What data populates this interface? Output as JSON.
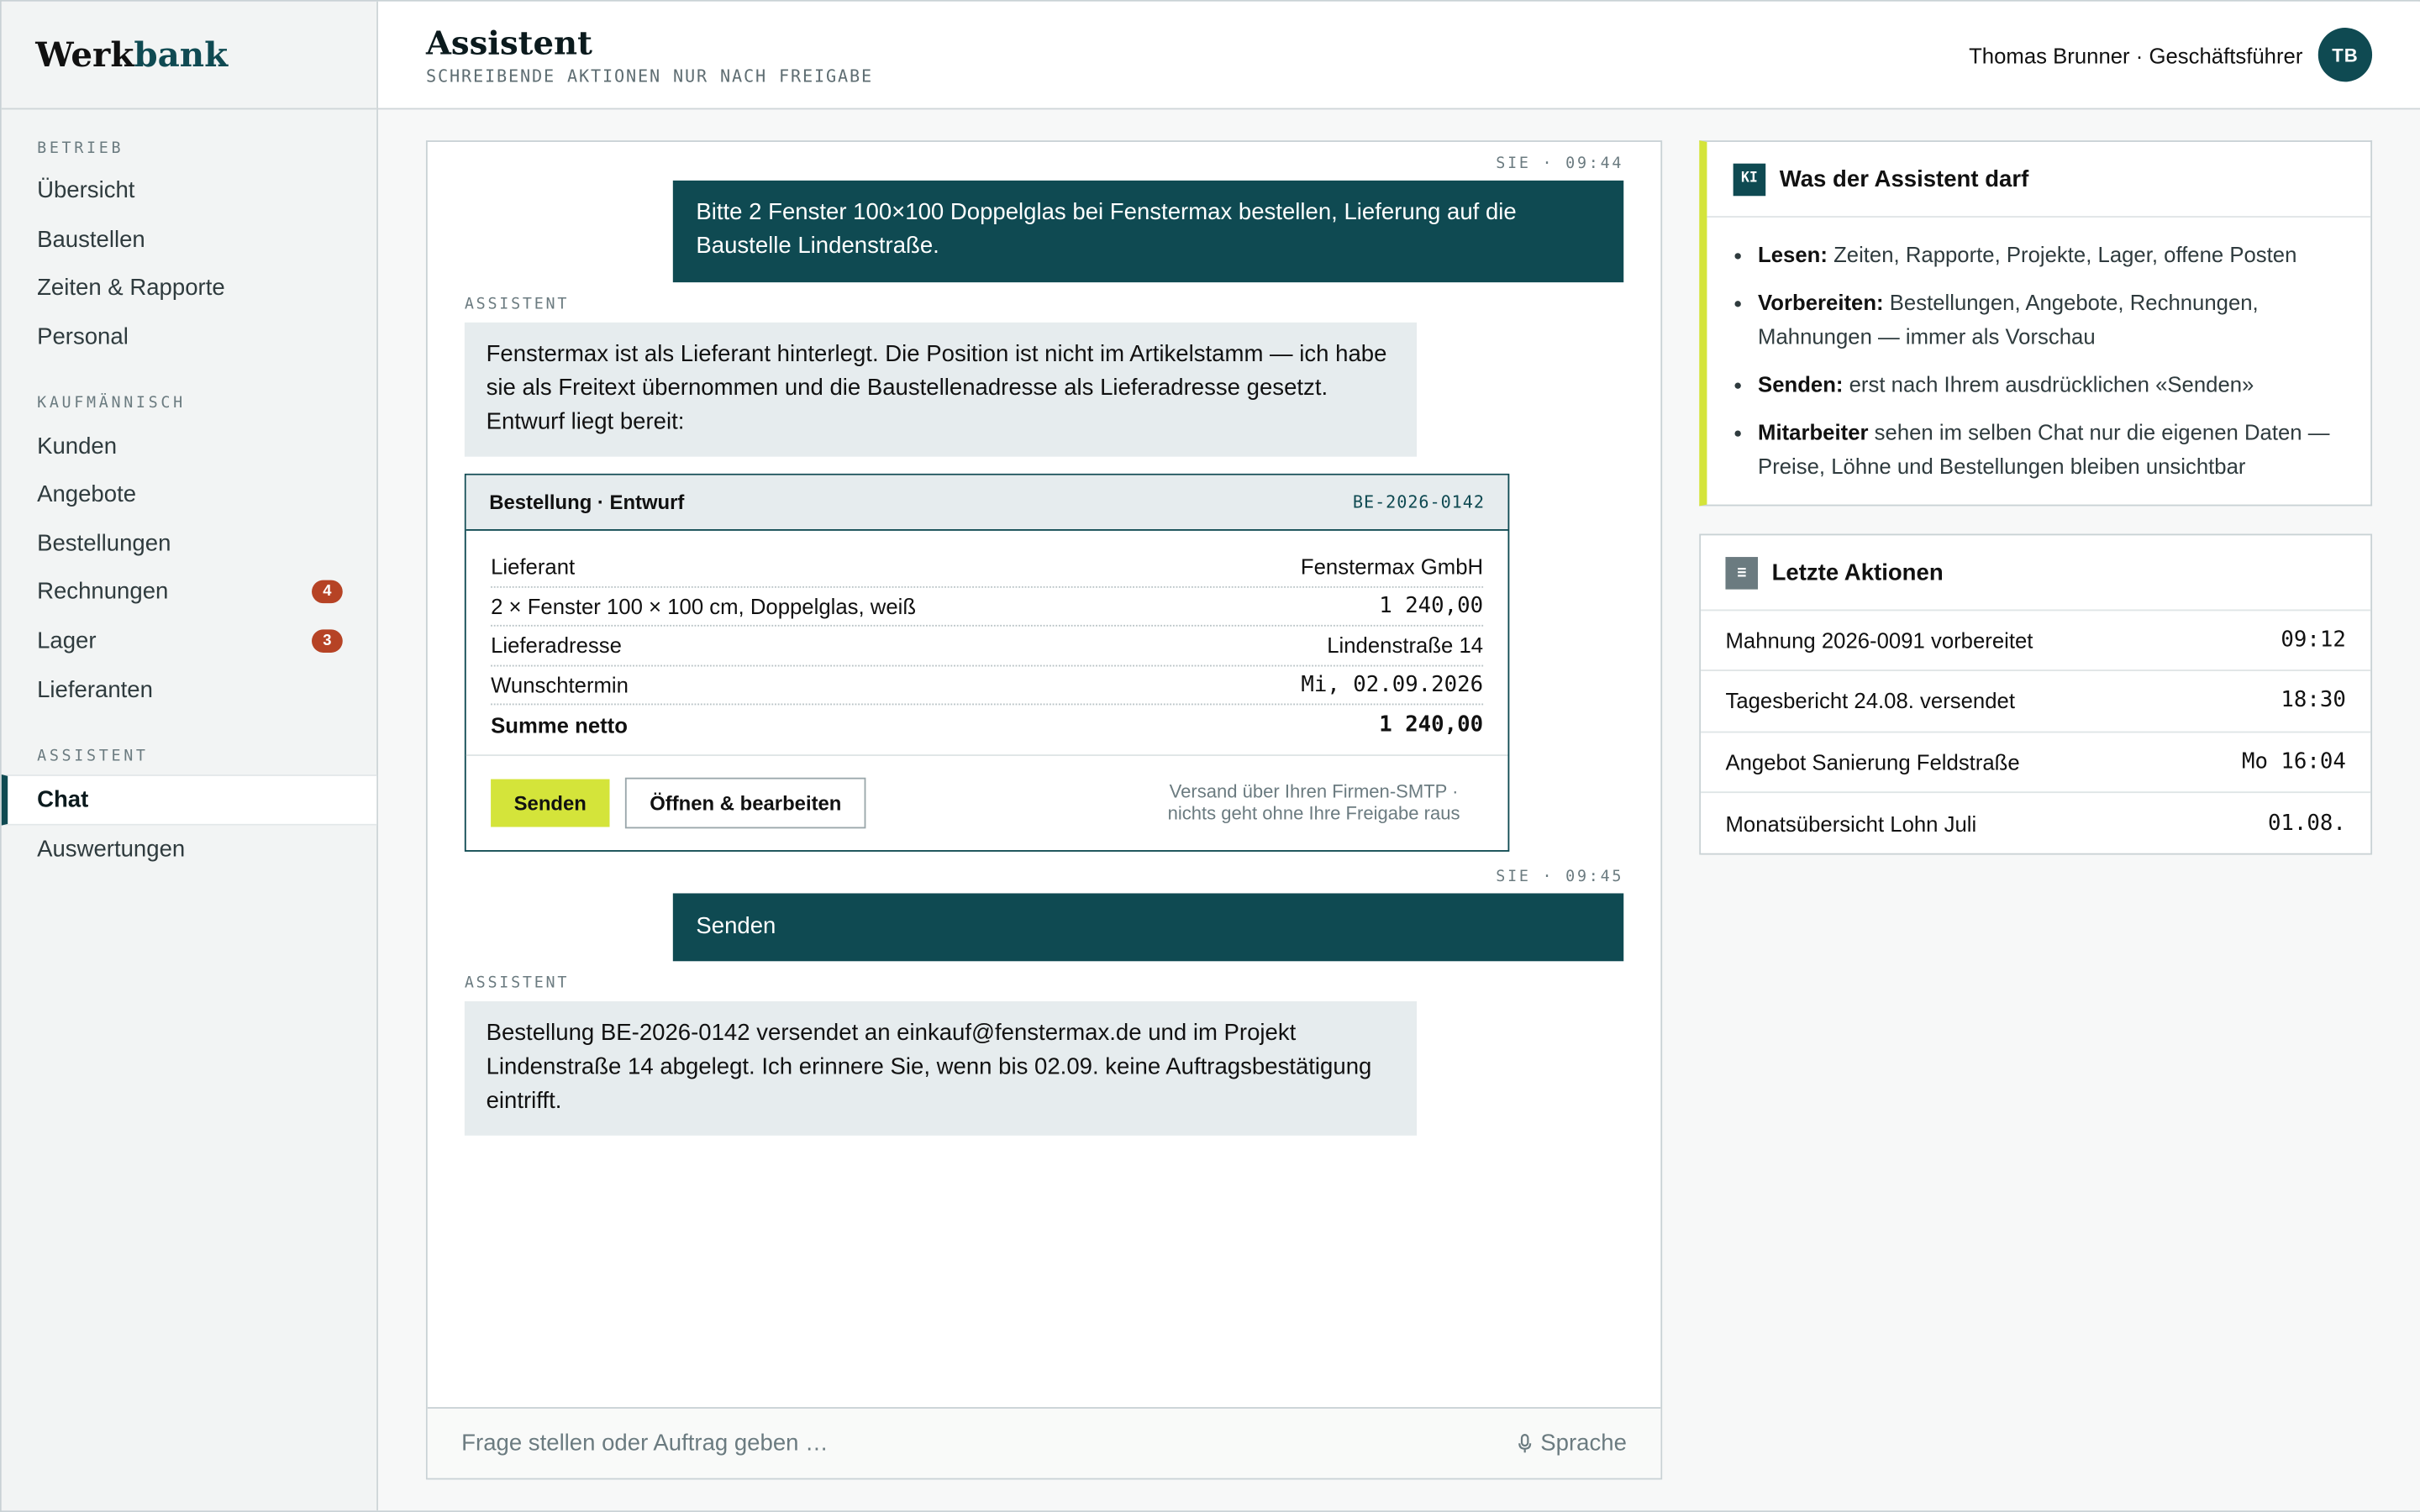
{
  "brand": {
    "part1": "Werk",
    "part2": "bank"
  },
  "sidebar": {
    "sections": [
      {
        "label": "BETRIEB"
      },
      {
        "label": "KAUFMÄNNISCH"
      },
      {
        "label": "ASSISTENT"
      }
    ],
    "items": [
      {
        "label": "Übersicht"
      },
      {
        "label": "Baustellen"
      },
      {
        "label": "Zeiten & Rapporte"
      },
      {
        "label": "Personal"
      },
      {
        "label": "Kunden"
      },
      {
        "label": "Angebote"
      },
      {
        "label": "Bestellungen"
      },
      {
        "label": "Rechnungen",
        "badge": "4"
      },
      {
        "label": "Lager",
        "badge": "3"
      },
      {
        "label": "Lieferanten"
      },
      {
        "label": "Chat",
        "active": true
      },
      {
        "label": "Auswertungen"
      }
    ]
  },
  "header": {
    "title": "Assistent",
    "subtitle": "SCHREIBENDE AKTIONEN NUR NACH FREIGABE",
    "user": "Thomas Brunner · Geschäftsführer",
    "avatar": "TB"
  },
  "chat": {
    "msg1": {
      "meta": "SIE · 09:44",
      "text": "Bitte 2 Fenster 100×100 Doppelglas bei Fenstermax bestellen, Lieferung auf die Baustelle Lindenstraße."
    },
    "msg2": {
      "meta": "ASSISTENT",
      "text": "Fenstermax ist als Lieferant hinterlegt. Die Position ist nicht im Artikelstamm — ich habe sie als Freitext übernommen und die Baustellenadresse als Lieferadresse gesetzt. Entwurf liegt bereit:"
    },
    "order": {
      "title": "Bestellung · Entwurf",
      "id": "BE-2026-0142",
      "rows": [
        {
          "label": "Lieferant",
          "value": "Fenstermax GmbH"
        },
        {
          "label": "2 × Fenster 100 × 100 cm, Doppelglas, weiß",
          "value": "1 240,00"
        },
        {
          "label": "Lieferadresse",
          "value": "Lindenstraße 14"
        },
        {
          "label": "Wunschtermin",
          "value": "Mi, 02.09.2026"
        },
        {
          "label": "Summe netto",
          "value": "1 240,00"
        }
      ],
      "send_label": "Senden",
      "edit_label": "Öffnen & bearbeiten",
      "note_line1": "Versand über Ihren Firmen-SMTP ·",
      "note_line2": "nichts geht ohne Ihre Freigabe raus"
    },
    "msg3": {
      "meta": "SIE · 09:45",
      "text": "Senden"
    },
    "msg4": {
      "meta": "ASSISTENT",
      "text": "Bestellung BE-2026-0142 versendet an einkauf@fenstermax.de und im Projekt Lindenstraße 14 abgelegt. Ich erinnere Sie, wenn bis 02.09. keine Auftragsbestätigung eintrifft."
    },
    "input_placeholder": "Frage stellen oder Auftrag geben …",
    "voice_label": "Sprache"
  },
  "panel_rules": {
    "chip": "KI",
    "title": "Was der Assistent darf",
    "items": [
      {
        "bold": "Lesen:",
        "text": " Zeiten, Rapporte, Projekte, Lager, offene Posten"
      },
      {
        "bold": "Vorbereiten:",
        "text": " Bestellungen, Angebote, Rechnungen, Mahnungen — immer als Vorschau"
      },
      {
        "bold": "Senden:",
        "text": " erst nach Ihrem ausdrücklichen «Senden»"
      },
      {
        "bold": "Mitarbeiter",
        "text": " sehen im selben Chat nur die eigenen Daten — Preise, Löhne und Bestellungen bleiben unsichtbar"
      }
    ]
  },
  "panel_actions": {
    "chip": "≡",
    "title": "Letzte Aktionen",
    "items": [
      {
        "label": "Mahnung 2026-0091 vorbereitet",
        "time": "09:12"
      },
      {
        "label": "Tagesbericht 24.08. versendet",
        "time": "18:30"
      },
      {
        "label": "Angebot Sanierung Feldstraße",
        "time": "Mo 16:04"
      },
      {
        "label": "Monatsübersicht Lohn Juli",
        "time": "01.08."
      }
    ]
  },
  "colors": {
    "accent": "#0f4a52",
    "highlight": "#d4e43a",
    "badge": "#b64325"
  }
}
